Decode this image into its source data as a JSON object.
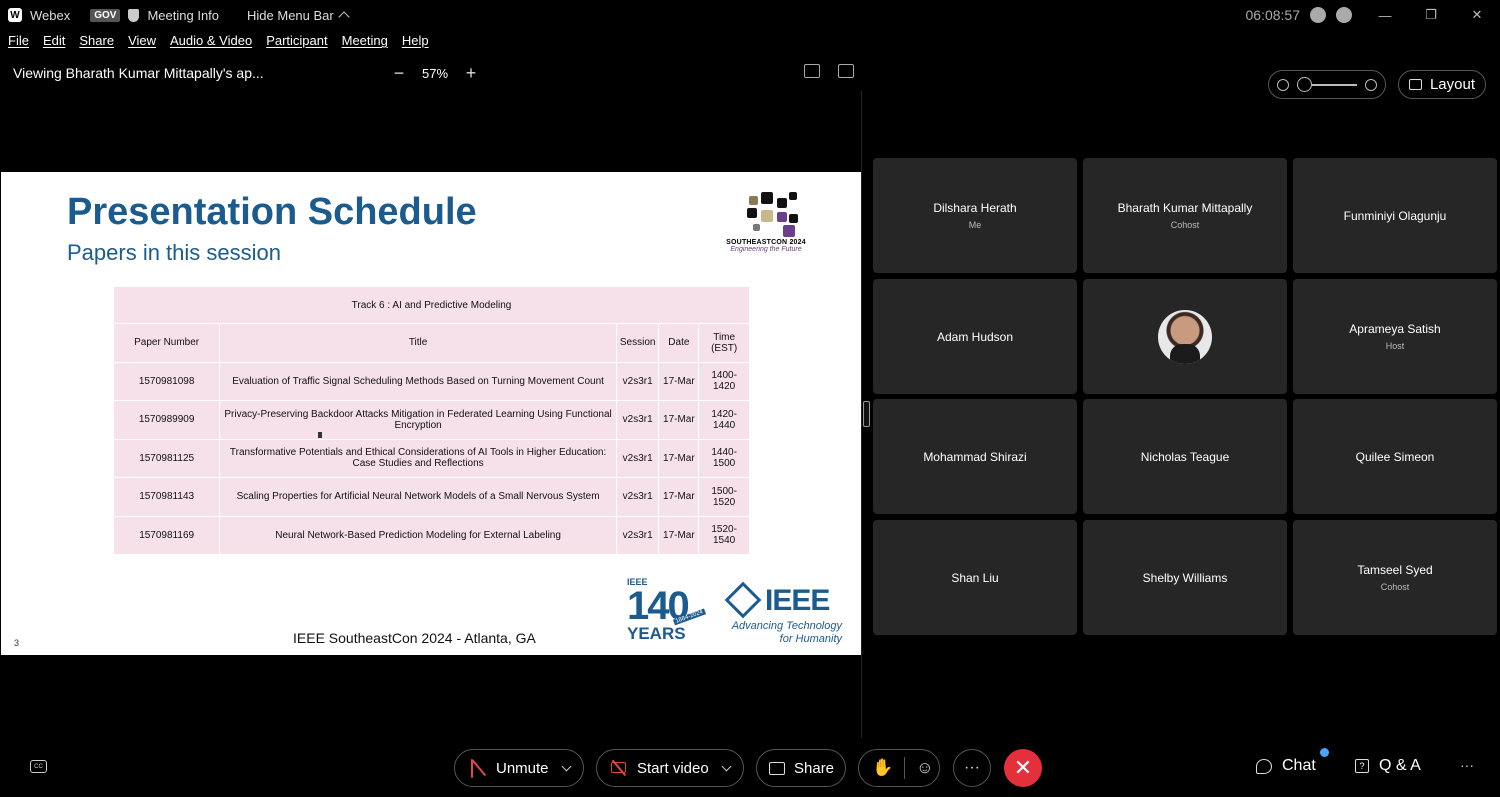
{
  "titlebar": {
    "app_name": "Webex",
    "gov_badge": "GOV",
    "meeting_info": "Meeting Info",
    "hide_menu": "Hide Menu Bar",
    "clock": "06:08:57"
  },
  "menu": [
    "File",
    "Edit",
    "Share",
    "View",
    "Audio & Video",
    "Participant",
    "Meeting",
    "Help"
  ],
  "viewbar": {
    "title": "Viewing Bharath Kumar Mittapally's ap...",
    "zoom_minus": "−",
    "zoom_level": "57%",
    "zoom_plus": "+"
  },
  "slide": {
    "title": "Presentation Schedule",
    "subtitle": "Papers in this session",
    "logo_text": "SOUTHEASTCON 2024",
    "logo_tag": "Engineering the Future",
    "table": {
      "track": "Track 6 : AI and Predictive Modeling",
      "headers": [
        "Paper Number",
        "Title",
        "Session",
        "Date",
        "Time (EST)"
      ],
      "rows": [
        [
          "1570981098",
          "Evaluation of Traffic Signal Scheduling Methods Based on Turning Movement Count",
          "v2s3r1",
          "17-Mar",
          "1400-1420"
        ],
        [
          "1570989909",
          "Privacy-Preserving Backdoor Attacks Mitigation in Federated Learning Using Functional Encryption",
          "v2s3r1",
          "17-Mar",
          "1420-1440"
        ],
        [
          "1570981125",
          "Transformative Potentials and Ethical Considerations of AI Tools in Higher Education: Case Studies and Reflections",
          "v2s3r1",
          "17-Mar",
          "1440-1500"
        ],
        [
          "1570981143",
          "Scaling Properties for Artificial Neural Network Models of a Small Nervous System",
          "v2s3r1",
          "17-Mar",
          "1500-1520"
        ],
        [
          "1570981169",
          "Neural Network-Based Prediction Modeling for External Labeling",
          "v2s3r1",
          "17-Mar",
          "1520-1540"
        ]
      ]
    },
    "footer": "IEEE SoutheastCon 2024 - Atlanta, GA",
    "slide_number": "3",
    "ieee140_small": "IEEE",
    "ieee140_big": "140",
    "ieee140_years": "YEARS",
    "ieee140_range": "1884-2024",
    "ieee_word": "IEEE",
    "ieee_tag1": "Advancing Technology",
    "ieee_tag2": "for Humanity"
  },
  "layout_label": "Layout",
  "participants": [
    {
      "name": "Dilshara Herath",
      "role": "Me"
    },
    {
      "name": "Bharath Kumar Mittapally",
      "role": "Cohost"
    },
    {
      "name": "Funminiyi Olagunju",
      "role": ""
    },
    {
      "name": "Adam Hudson",
      "role": ""
    },
    {
      "name": "",
      "role": "",
      "avatar": true
    },
    {
      "name": "Aprameya Satish",
      "role": "Host"
    },
    {
      "name": "Mohammad Shirazi",
      "role": ""
    },
    {
      "name": "Nicholas Teague",
      "role": ""
    },
    {
      "name": "Quilee Simeon",
      "role": ""
    },
    {
      "name": "Shan Liu",
      "role": ""
    },
    {
      "name": "Shelby Williams",
      "role": ""
    },
    {
      "name": "Tamseel Syed",
      "role": "Cohost"
    }
  ],
  "controls": {
    "cc": "CC",
    "unmute": "Unmute",
    "start_video": "Start video",
    "share": "Share",
    "more": "···",
    "end": "✕",
    "chat": "Chat",
    "qa": "Q & A",
    "overflow": "···"
  },
  "colors": {
    "slide_blue": "#1c5b8e",
    "table_pink": "#f6e1ea",
    "tile_bg": "#262626",
    "end_red": "#e3303a",
    "muted_red": "#e04848"
  }
}
